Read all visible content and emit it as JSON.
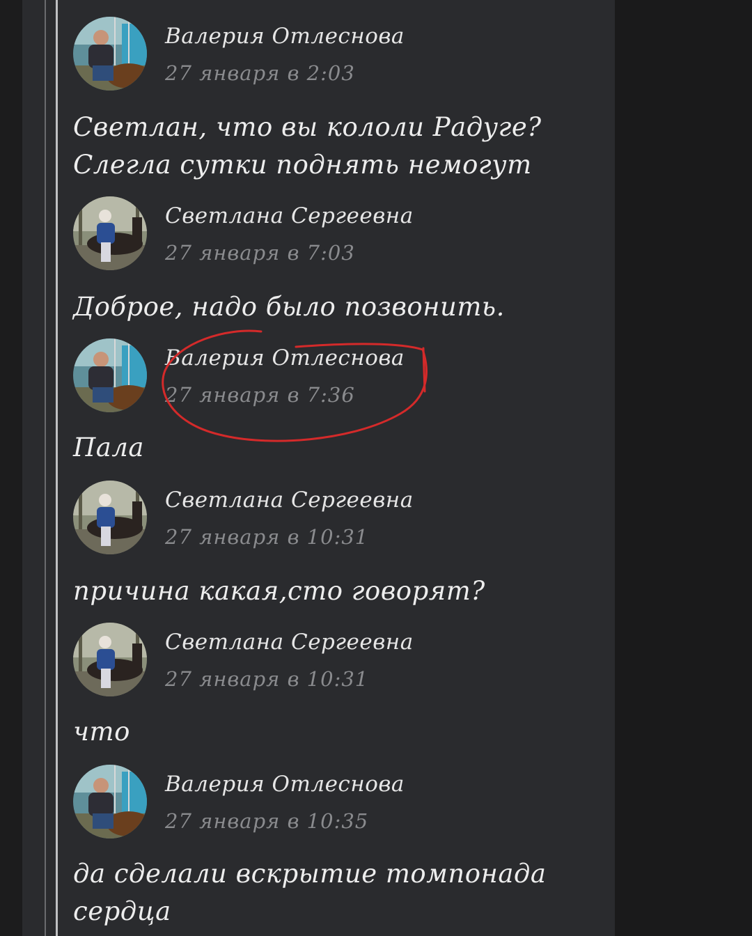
{
  "colors": {
    "page_background": "#1c1c1d",
    "panel_background": "#2a2b2e",
    "author_text": "#e6e6e6",
    "timestamp_text": "#8a8b8e",
    "message_text": "#ededed",
    "annotation_circle": "#d42a2a"
  },
  "comments": [
    {
      "author": "Валерия Отлеснова",
      "timestamp": "27 января в 2:03",
      "avatar": "avatar-valeria",
      "message_lines": [
        "Светлан, что вы кололи Радуге?",
        "Слегла сутки поднять немогут"
      ]
    },
    {
      "author": "Светлана Сергеевна",
      "timestamp": "27 января в 7:03",
      "avatar": "avatar-svetlana",
      "message_lines": [
        "Доброе, надо было позвонить."
      ]
    },
    {
      "author": "Валерия Отлеснова",
      "timestamp": "27 января в 7:36",
      "avatar": "avatar-valeria",
      "message_lines": [
        "Пала"
      ]
    },
    {
      "author": "Светлана Сергеевна",
      "timestamp": "27 января в 10:31",
      "avatar": "avatar-svetlana",
      "message_lines": [
        "причина какая,сто говорят?"
      ]
    },
    {
      "author": "Светлана Сергеевна",
      "timestamp": "27 января в 10:31",
      "avatar": "avatar-svetlana",
      "message_lines": [
        "что"
      ]
    },
    {
      "author": "Валерия Отлеснова",
      "timestamp": "27 января в 10:35",
      "avatar": "avatar-valeria",
      "message_lines": [
        "да сделали вскрытие томпонада",
        "сердца"
      ]
    }
  ]
}
